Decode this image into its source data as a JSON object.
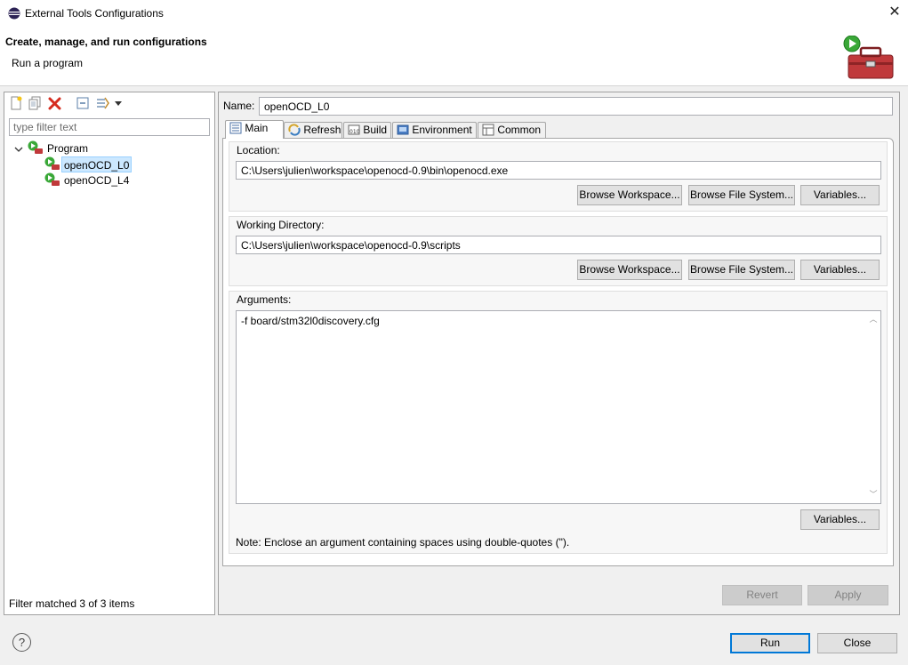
{
  "window": {
    "title": "External Tools Configurations"
  },
  "banner": {
    "title": "Create, manage, and run configurations",
    "subtitle": "Run a program"
  },
  "left": {
    "filter_placeholder": "type filter text",
    "tree": {
      "group": "Program",
      "items": [
        "openOCD_L0",
        "openOCD_L4"
      ],
      "selected": "openOCD_L0"
    },
    "status": "Filter matched 3 of 3 items"
  },
  "right": {
    "name_label": "Name:",
    "name_value": "openOCD_L0",
    "tabs": [
      "Main",
      "Refresh",
      "Build",
      "Environment",
      "Common"
    ],
    "active_tab": "Main",
    "location": {
      "label": "Location:",
      "value": "C:\\Users\\julien\\workspace\\openocd-0.9\\bin\\openocd.exe"
    },
    "working_dir": {
      "label": "Working Directory:",
      "value": "C:\\Users\\julien\\workspace\\openocd-0.9\\scripts"
    },
    "arguments": {
      "label": "Arguments:",
      "value": "-f board/stm32l0discovery.cfg",
      "note": "Note: Enclose an argument containing spaces using double-quotes (\")."
    },
    "buttons": {
      "browse_workspace": "Browse Workspace...",
      "browse_fs": "Browse File System...",
      "variables": "Variables...",
      "revert": "Revert",
      "apply": "Apply"
    }
  },
  "footer": {
    "run": "Run",
    "close": "Close",
    "help": "?"
  },
  "colors": {
    "selection": "#cce8ff",
    "default_button_border": "#0078d7"
  }
}
